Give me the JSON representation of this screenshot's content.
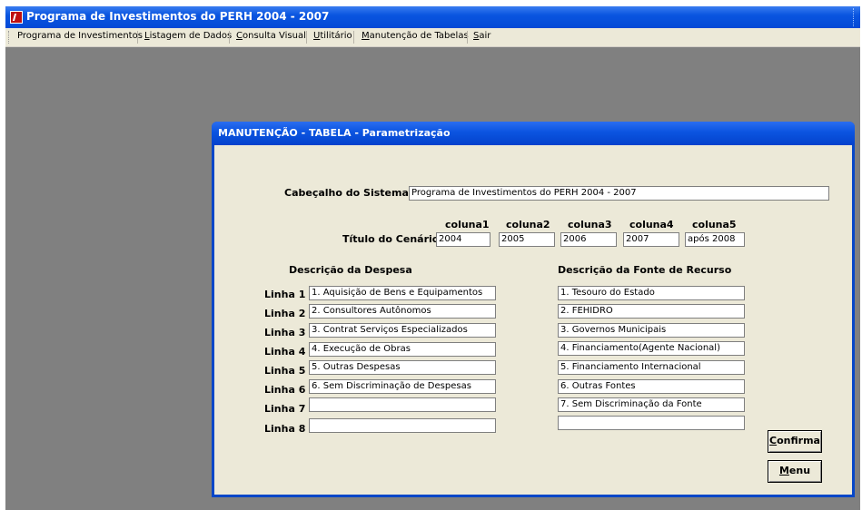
{
  "app": {
    "title": "Programa de Investimentos do PERH 2004 - 2007"
  },
  "menu": [
    "Programa de Investimentos",
    "Listagem de Dados",
    "Consulta Visual",
    "Utilitário",
    "Manutenção de Tabelas",
    "Sair"
  ],
  "dialog": {
    "title": "MANUTENÇÃO - TABELA - Parametrização",
    "cabecalho_label": "Cabeçalho do Sistema:",
    "cabecalho_value": "Programa de Investimentos do PERH 2004 - 2007",
    "titulo_label": "Título do Cenário",
    "colunas": [
      "coluna1",
      "coluna2",
      "coluna3",
      "coluna4",
      "coluna5"
    ],
    "coluna_values": [
      "2004",
      "2005",
      "2006",
      "2007",
      "após 2008"
    ],
    "despesa_header": "Descrição da Despesa",
    "fonte_header": "Descrição da Fonte de Recurso",
    "linhas": [
      "Linha 1",
      "Linha 2",
      "Linha 3",
      "Linha 4",
      "Linha 5",
      "Linha 6",
      "Linha 7",
      "Linha 8"
    ],
    "despesas": [
      "1. Aquisição de Bens e Equipamentos",
      "2. Consultores Autônomos",
      "3. Contrat Serviços Especializados",
      "4. Execução de Obras",
      "5. Outras Despesas",
      "6. Sem Discriminação de Despesas",
      "",
      ""
    ],
    "fontes": [
      "1. Tesouro do Estado",
      "2. FEHIDRO",
      "3. Governos Municipais",
      "4. Financiamento(Agente Nacional)",
      "5. Financiamento Internacional",
      "6. Outras Fontes",
      "7. Sem Discriminação da Fonte",
      ""
    ],
    "confirma_label": "Confirma",
    "menu_label": "Menu"
  }
}
